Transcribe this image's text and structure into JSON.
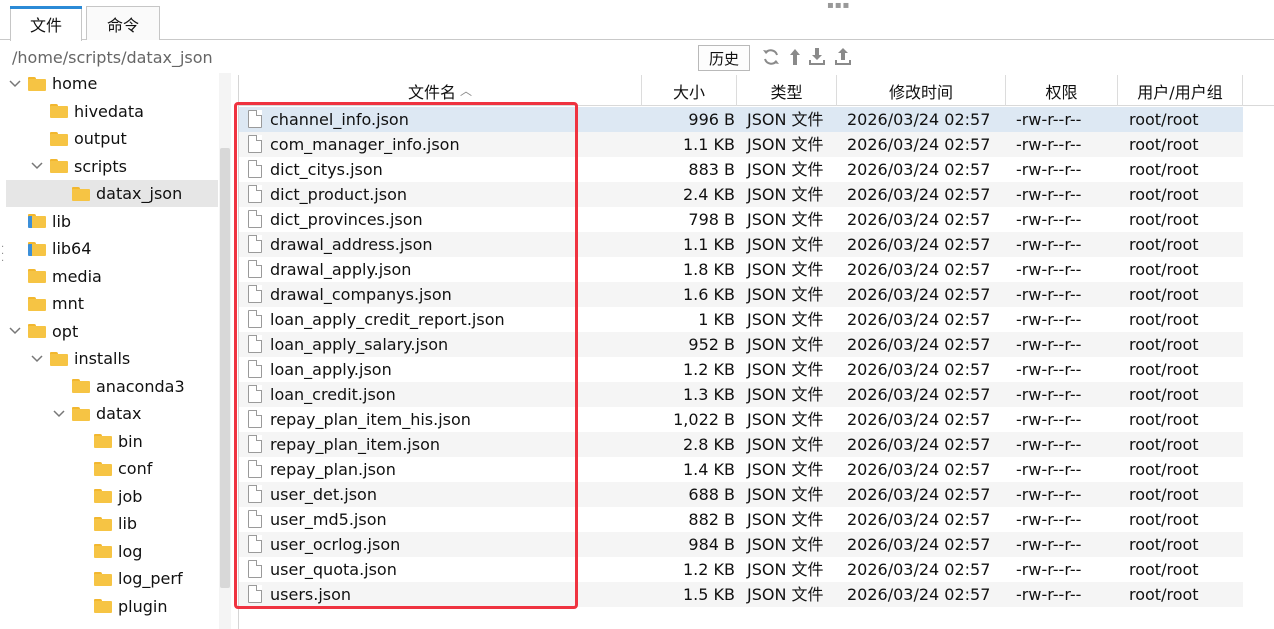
{
  "tabs": [
    {
      "label": "文件",
      "active": true
    },
    {
      "label": "命令",
      "active": false
    }
  ],
  "path": {
    "value": "/home/scripts/datax_json",
    "history_label": "历史"
  },
  "toolbar_icons": [
    "refresh-icon",
    "up-dir-icon",
    "download-icon",
    "upload-icon"
  ],
  "tree": [
    {
      "label": "home",
      "depth": 0,
      "expanded": true,
      "chev": "down"
    },
    {
      "label": "hivedata",
      "depth": 1
    },
    {
      "label": "output",
      "depth": 1
    },
    {
      "label": "scripts",
      "depth": 1,
      "expanded": true,
      "chev": "down"
    },
    {
      "label": "datax_json",
      "depth": 2,
      "selected": true
    },
    {
      "label": "lib",
      "depth": 0,
      "link": true
    },
    {
      "label": "lib64",
      "depth": 0,
      "link": true
    },
    {
      "label": "media",
      "depth": 0
    },
    {
      "label": "mnt",
      "depth": 0
    },
    {
      "label": "opt",
      "depth": 0,
      "expanded": true,
      "chev": "down"
    },
    {
      "label": "installs",
      "depth": 1,
      "expanded": true,
      "chev": "down"
    },
    {
      "label": "anaconda3",
      "depth": 2
    },
    {
      "label": "datax",
      "depth": 2,
      "expanded": true,
      "chev": "down"
    },
    {
      "label": "bin",
      "depth": 3
    },
    {
      "label": "conf",
      "depth": 3
    },
    {
      "label": "job",
      "depth": 3
    },
    {
      "label": "lib",
      "depth": 3
    },
    {
      "label": "log",
      "depth": 3
    },
    {
      "label": "log_perf",
      "depth": 3
    },
    {
      "label": "plugin",
      "depth": 3
    }
  ],
  "columns": [
    "文件名",
    "大小",
    "类型",
    "修改时间",
    "权限",
    "用户/用户组"
  ],
  "sort": {
    "column": "文件名",
    "direction": "asc"
  },
  "files": [
    {
      "name": "channel_info.json",
      "size": "996 B",
      "type": "JSON 文件",
      "modified": "2026/03/24 02:57",
      "perm": "-rw-r--r--",
      "owner": "root/root"
    },
    {
      "name": "com_manager_info.json",
      "size": "1.1 KB",
      "type": "JSON 文件",
      "modified": "2026/03/24 02:57",
      "perm": "-rw-r--r--",
      "owner": "root/root"
    },
    {
      "name": "dict_citys.json",
      "size": "883 B",
      "type": "JSON 文件",
      "modified": "2026/03/24 02:57",
      "perm": "-rw-r--r--",
      "owner": "root/root"
    },
    {
      "name": "dict_product.json",
      "size": "2.4 KB",
      "type": "JSON 文件",
      "modified": "2026/03/24 02:57",
      "perm": "-rw-r--r--",
      "owner": "root/root"
    },
    {
      "name": "dict_provinces.json",
      "size": "798 B",
      "type": "JSON 文件",
      "modified": "2026/03/24 02:57",
      "perm": "-rw-r--r--",
      "owner": "root/root"
    },
    {
      "name": "drawal_address.json",
      "size": "1.1 KB",
      "type": "JSON 文件",
      "modified": "2026/03/24 02:57",
      "perm": "-rw-r--r--",
      "owner": "root/root"
    },
    {
      "name": "drawal_apply.json",
      "size": "1.8 KB",
      "type": "JSON 文件",
      "modified": "2026/03/24 02:57",
      "perm": "-rw-r--r--",
      "owner": "root/root"
    },
    {
      "name": "drawal_companys.json",
      "size": "1.6 KB",
      "type": "JSON 文件",
      "modified": "2026/03/24 02:57",
      "perm": "-rw-r--r--",
      "owner": "root/root"
    },
    {
      "name": "loan_apply_credit_report.json",
      "size": "1 KB",
      "type": "JSON 文件",
      "modified": "2026/03/24 02:57",
      "perm": "-rw-r--r--",
      "owner": "root/root"
    },
    {
      "name": "loan_apply_salary.json",
      "size": "952 B",
      "type": "JSON 文件",
      "modified": "2026/03/24 02:57",
      "perm": "-rw-r--r--",
      "owner": "root/root"
    },
    {
      "name": "loan_apply.json",
      "size": "1.2 KB",
      "type": "JSON 文件",
      "modified": "2026/03/24 02:57",
      "perm": "-rw-r--r--",
      "owner": "root/root"
    },
    {
      "name": "loan_credit.json",
      "size": "1.3 KB",
      "type": "JSON 文件",
      "modified": "2026/03/24 02:57",
      "perm": "-rw-r--r--",
      "owner": "root/root"
    },
    {
      "name": "repay_plan_item_his.json",
      "size": "1,022 B",
      "type": "JSON 文件",
      "modified": "2026/03/24 02:57",
      "perm": "-rw-r--r--",
      "owner": "root/root"
    },
    {
      "name": "repay_plan_item.json",
      "size": "2.8 KB",
      "type": "JSON 文件",
      "modified": "2026/03/24 02:57",
      "perm": "-rw-r--r--",
      "owner": "root/root"
    },
    {
      "name": "repay_plan.json",
      "size": "1.4 KB",
      "type": "JSON 文件",
      "modified": "2026/03/24 02:57",
      "perm": "-rw-r--r--",
      "owner": "root/root"
    },
    {
      "name": "user_det.json",
      "size": "688 B",
      "type": "JSON 文件",
      "modified": "2026/03/24 02:57",
      "perm": "-rw-r--r--",
      "owner": "root/root"
    },
    {
      "name": "user_md5.json",
      "size": "882 B",
      "type": "JSON 文件",
      "modified": "2026/03/24 02:57",
      "perm": "-rw-r--r--",
      "owner": "root/root"
    },
    {
      "name": "user_ocrlog.json",
      "size": "984 B",
      "type": "JSON 文件",
      "modified": "2026/03/24 02:57",
      "perm": "-rw-r--r--",
      "owner": "root/root"
    },
    {
      "name": "user_quota.json",
      "size": "1.2 KB",
      "type": "JSON 文件",
      "modified": "2026/03/24 02:57",
      "perm": "-rw-r--r--",
      "owner": "root/root"
    },
    {
      "name": "users.json",
      "size": "1.5 KB",
      "type": "JSON 文件",
      "modified": "2026/03/24 02:57",
      "perm": "-rw-r--r--",
      "owner": "root/root"
    }
  ],
  "colors": {
    "accent": "#2b8ad6",
    "highlight": "#ef3340",
    "selected_row": "#dde8f3",
    "folder": "#f6c444"
  }
}
